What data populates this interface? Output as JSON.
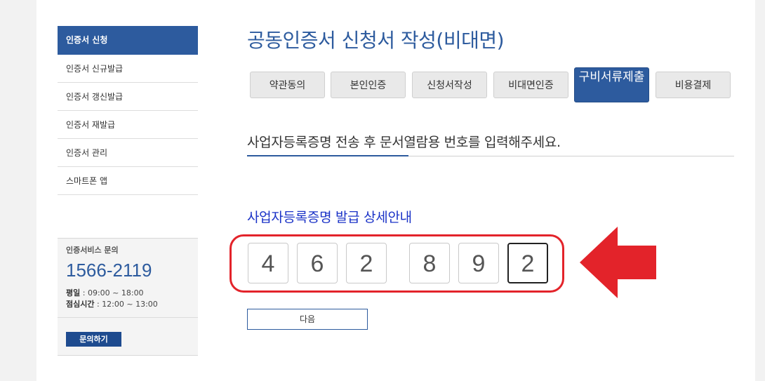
{
  "sidebar": {
    "header": "인증서 신청",
    "items": [
      {
        "label": "인증서 신규발급"
      },
      {
        "label": "인증서 갱신발급"
      },
      {
        "label": "인증서 재발급"
      },
      {
        "label": "인증서 관리"
      },
      {
        "label": "스마트폰 앱"
      }
    ],
    "contact": {
      "title": "인증서비스 문의",
      "phone": "1566-2119",
      "weekday_label": "평일",
      "weekday_hours": " : 09:00 ~ 18:00",
      "lunch_label": "점심시간",
      "lunch_hours": " : 12:00 ~ 13:00",
      "button": "문의하기"
    }
  },
  "main": {
    "title": "공동인증서 신청서 작성(비대면)",
    "steps": [
      {
        "label": "약관동의",
        "active": false
      },
      {
        "label": "본인인증",
        "active": false
      },
      {
        "label": "신청서작성",
        "active": false
      },
      {
        "label": "비대면인증",
        "active": false
      },
      {
        "label": "구비서류제출",
        "active": true
      },
      {
        "label": "비용결제",
        "active": false
      }
    ],
    "instruction": "사업자등록증명 전송 후 문서열람용 번호를 입력해주세요.",
    "section_title": "사업자등록증명 발급 상세안내",
    "code_digits": [
      "4",
      "6",
      "2",
      "8",
      "9",
      "2"
    ],
    "focused_digit_index": 5,
    "next_button": "다음"
  },
  "colors": {
    "accent": "#2d5b9e",
    "highlight_red": "#e3232a",
    "link_blue": "#1a32c7"
  }
}
